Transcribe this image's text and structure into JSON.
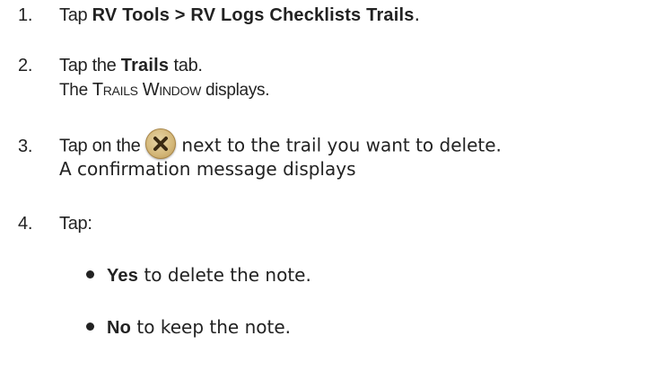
{
  "steps": [
    {
      "number": "1.",
      "prefix": "Tap ",
      "bold": "RV Tools > RV Logs Checklists Trails",
      "suffix": "."
    },
    {
      "number": "2.",
      "prefix": "Tap the ",
      "bold": "Trails",
      "suffix": " tab.",
      "result": {
        "prefix": "The ",
        "sc1_big": "T",
        "sc1_small": "RAILS",
        "space": " ",
        "sc2_big": "W",
        "sc2_small": "INDOW",
        "suffix": " displays."
      }
    },
    {
      "number": "3.",
      "prefix": "Tap on the",
      "icon": "delete-x-icon",
      "suffix": "next to the trail you want to delete.",
      "result": "A confirmation message displays"
    },
    {
      "number": "4.",
      "text": "Tap:",
      "options": [
        {
          "bold": "Yes",
          "text": " to delete the note."
        },
        {
          "bold": "No",
          "text": " to keep the note."
        }
      ]
    }
  ]
}
